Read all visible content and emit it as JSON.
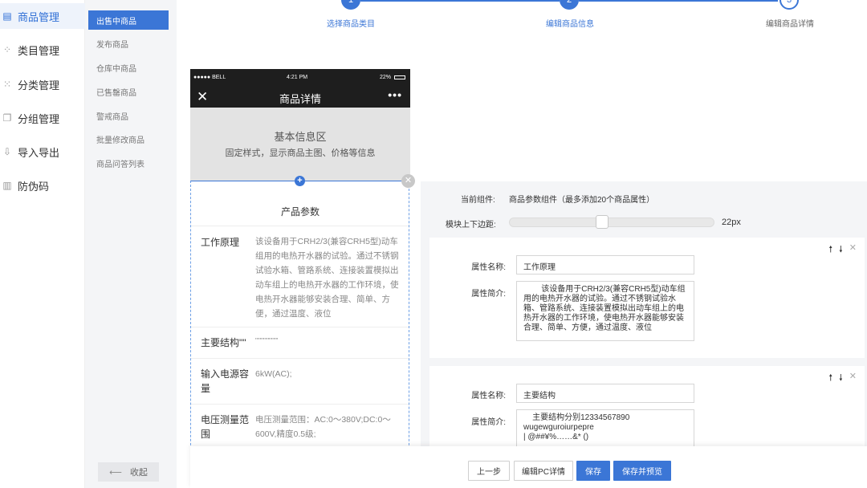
{
  "nav_primary": [
    {
      "label": "商品管理",
      "icon": "file-icon",
      "active": true
    },
    {
      "label": "类目管理",
      "icon": "category-icon",
      "active": false
    },
    {
      "label": "分类管理",
      "icon": "grid-icon",
      "active": false
    },
    {
      "label": "分组管理",
      "icon": "group-icon",
      "active": false
    },
    {
      "label": "导入导出",
      "icon": "import-icon",
      "active": false
    },
    {
      "label": "防伪码",
      "icon": "barcode-icon",
      "active": false
    }
  ],
  "nav_secondary": [
    {
      "label": "出售中商品",
      "active": true
    },
    {
      "label": "发布商品",
      "active": false
    },
    {
      "label": "仓库中商品",
      "active": false
    },
    {
      "label": "已售罄商品",
      "active": false
    },
    {
      "label": "警戒商品",
      "active": false
    },
    {
      "label": "批量修改商品",
      "active": false
    },
    {
      "label": "商品问答列表",
      "active": false
    }
  ],
  "collapse_label": "收起",
  "steps": [
    {
      "num": "1",
      "label": "选择商品类目",
      "state": "done"
    },
    {
      "num": "2",
      "label": "编辑商品信息",
      "state": "done"
    },
    {
      "num": "3",
      "label": "编辑商品详情",
      "state": "todo"
    }
  ],
  "phone": {
    "carrier": "●●●●● BELL",
    "time": "4:21 PM",
    "battery": "22%",
    "title": "商品详情",
    "close_glyph": "✕",
    "more_glyph": "•••",
    "basic_title": "基本信息区",
    "basic_desc": "固定样式，显示商品主图、价格等信息",
    "params_title": "产品参数",
    "params": [
      {
        "key": "工作原理",
        "value": "        该设备用于CRH2/3(兼容CRH5型)动车组用的电热开水器的试验。通过不锈钢试验水箱、管路系统、连接装置模拟出动车组上的电热开水器的工作环境，使电热开水器能够安装合理、简单、方便，通过温度、液位"
      },
      {
        "key": "主要结构\"\"",
        "value": "\"\"\"\"\"\"\"\"\"\""
      },
      {
        "key": "输入电源容量",
        "value": "6kW(AC);"
      },
      {
        "key": "电压测量范围",
        "value": "电压测量范围：AC:0～380V;DC:0～600V,精度0.5级;"
      }
    ]
  },
  "panel": {
    "current_label": "当前组件:",
    "current_value": "商品参数组件（最多添加20个商品属性）",
    "margin_label": "模块上下边距:",
    "margin_value": "22px",
    "margin_fraction": 0.45,
    "name_label": "属性名称:",
    "intro_label": "属性简介:",
    "up_glyph": "🠕",
    "down_glyph": "🠗",
    "remove_glyph": "✕",
    "cards": [
      {
        "name": "工作原理",
        "intro": "        该设备用于CRH2/3(兼容CRH5型)动车组用的电热开水器的试验。通过不锈钢试验水箱、管路系统、连接装置模拟出动车组上的电热开水器的工作环境，使电热开水器能够安装合理、简单、方便，通过温度、液位"
      },
      {
        "name": "主要结构",
        "intro": "    主要结构分别12334567890\nwugewguroiurpepre\n| @##¥%……&* ()"
      }
    ]
  },
  "buttons": {
    "prev": "上一步",
    "edit_pc": "编辑PC详情",
    "save": "保存",
    "save_preview": "保存并预览"
  }
}
